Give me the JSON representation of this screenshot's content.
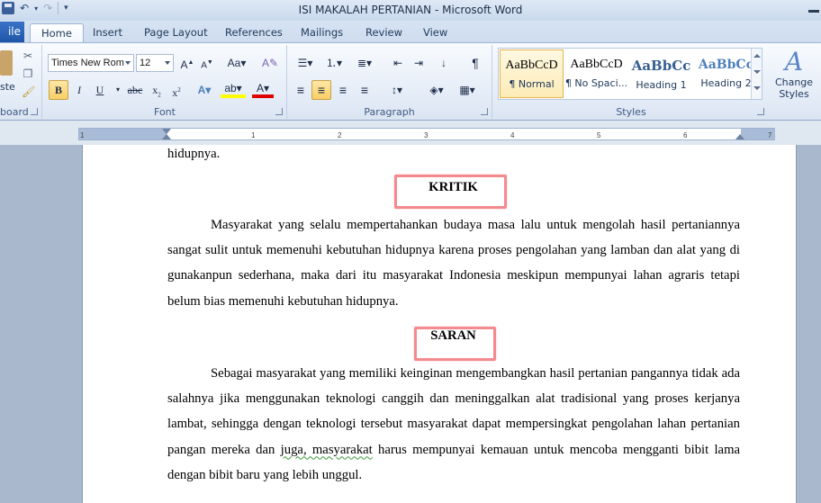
{
  "window": {
    "title": "ISI MAKALAH PERTANIAN  -  Microsoft Word"
  },
  "tabs": [
    {
      "label": "ile",
      "key": "file"
    },
    {
      "label": "Home",
      "key": "home"
    },
    {
      "label": "Insert",
      "key": "insert"
    },
    {
      "label": "Page Layout",
      "key": "page-layout"
    },
    {
      "label": "References",
      "key": "references"
    },
    {
      "label": "Mailings",
      "key": "mailings"
    },
    {
      "label": "Review",
      "key": "review"
    },
    {
      "label": "View",
      "key": "view"
    }
  ],
  "ribbon": {
    "clipboard": {
      "paste_label": "ste",
      "group_label": "board"
    },
    "font": {
      "name": "Times New Rom",
      "size": "12",
      "group_label": "Font"
    },
    "paragraph": {
      "group_label": "Paragraph"
    },
    "styles": {
      "group_label": "Styles",
      "items": [
        {
          "sample": "AaBbCcD",
          "name": "¶ Normal"
        },
        {
          "sample": "AaBbCcD",
          "name": "¶ No Spaci..."
        },
        {
          "sample": "AaBbCc",
          "name": "Heading 1"
        },
        {
          "sample": "AaBbCc",
          "name": "Heading 2"
        }
      ],
      "change_styles": "Change Styles"
    }
  },
  "ruler": {
    "numbers": [
      "1",
      "1",
      "2",
      "3",
      "4",
      "5",
      "6",
      "7"
    ]
  },
  "document": {
    "prev_line": "hidupnya.",
    "heading1": "KRITIK",
    "para1": "Masyarakat yang selalu mempertahankan budaya masa lalu untuk mengolah hasil pertaniannya sangat sulit untuk memenuhi kebutuhan hidupnya karena proses pengolahan yang lamban dan alat yang di gunakanpun sederhana, maka dari itu masyarakat Indonesia meskipun mempunyai lahan agraris tetapi belum bias memenuhi kebutuhan hidupnya.",
    "heading2": "SARAN",
    "para2_start": "Sebagai masyarakat yang memiliki keinginan mengembangkan hasil pertanian pangannya tidak ada salahnya jika menggunakan teknologi canggih dan meninggalkan alat tradisional yang proses kerjanya lambat, sehingga dengan teknologi tersebut masyarakat dapat mempersingkat pengolahan lahan pertanian pangan mereka dan",
    "para2_flag": "juga,  masyarakat",
    "para2_end": "harus mempunyai kemauan untuk mencoba mengganti bibit lama dengan bibit baru yang lebih unggul."
  },
  "colors": {
    "highlight_box": "#f28a8e",
    "ribbon_accent": "#1f56a8"
  }
}
